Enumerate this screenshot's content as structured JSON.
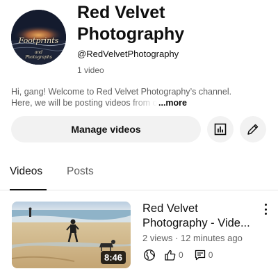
{
  "channel": {
    "name_line1": "Red Velvet",
    "name_line2": "Photography",
    "handle": "@RedVelvetPhotography",
    "video_count": "1 video",
    "avatar_text_line1": "Footprints",
    "avatar_text_line2": "and",
    "avatar_text_line3": "Photographs"
  },
  "description": {
    "line1": "Hi, gang! Welcome to Red Velvet Photography’s channel.",
    "line2": "Here, we will be posting videos from our adventures",
    "more_label": "...more"
  },
  "actions": {
    "manage_label": "Manage videos",
    "stats_icon": "analytics-icon",
    "edit_icon": "pencil-icon"
  },
  "tabs": [
    {
      "label": "Videos",
      "selected": true
    },
    {
      "label": "Posts",
      "selected": false
    }
  ],
  "videos": [
    {
      "title_line1": "Red Velvet",
      "title_line2": "Photography - Vide...",
      "meta": "2 views · 12 minutes ago",
      "duration": "8:46",
      "likes": "0",
      "comments": "0",
      "visibility_icon": "globe-icon"
    }
  ],
  "colors": {
    "text_primary": "#0f0f0f",
    "text_secondary": "#606060",
    "button_bg": "#f2f2f2",
    "divider": "#e5e5e5"
  }
}
